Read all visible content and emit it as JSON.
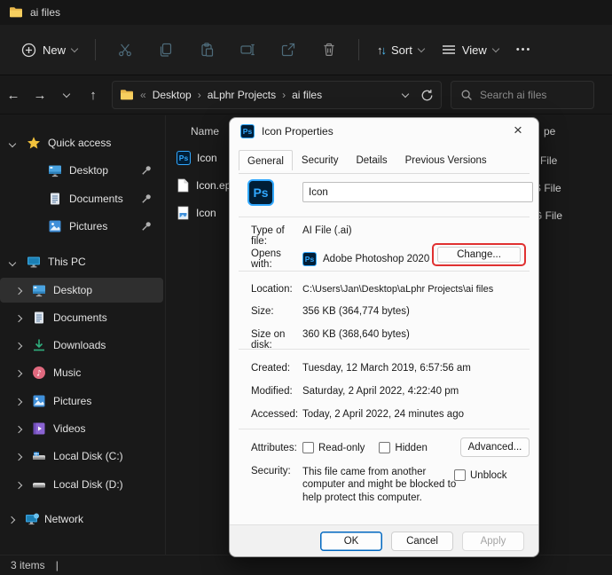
{
  "window": {
    "title": "ai files"
  },
  "icons": {
    "back": "←",
    "forward": "→",
    "up": "↑",
    "overflow": "«",
    "crumb_sep": "›",
    "ellipsis": "•••",
    "sort_up": "↑",
    "sort_down": "↓",
    "close": "×",
    "music_note": "♪",
    "status_divider": "|",
    "ps": "Ps"
  },
  "toolbar": {
    "new_label": "New",
    "sort_label": "Sort",
    "view_label": "View"
  },
  "addressbar": {
    "crumbs": [
      "Desktop",
      "aLphr Projects",
      "ai files"
    ]
  },
  "search": {
    "placeholder": "Search ai files"
  },
  "sidebar": {
    "quick_access": {
      "label": "Quick access",
      "items": [
        {
          "label": "Desktop"
        },
        {
          "label": "Documents"
        },
        {
          "label": "Pictures"
        }
      ]
    },
    "this_pc": {
      "label": "This PC",
      "items": [
        {
          "label": "Desktop"
        },
        {
          "label": "Documents"
        },
        {
          "label": "Downloads"
        },
        {
          "label": "Music"
        },
        {
          "label": "Pictures"
        },
        {
          "label": "Videos"
        },
        {
          "label": "Local Disk (C:)"
        },
        {
          "label": "Local Disk (D:)"
        }
      ]
    },
    "network": {
      "label": "Network"
    }
  },
  "filelist": {
    "name_header": "Name",
    "type_header_visible": "pe",
    "items": [
      {
        "name": "Icon",
        "type": "File"
      },
      {
        "name": "Icon.ep",
        "type": "S File"
      },
      {
        "name": "Icon",
        "type": "G File"
      }
    ]
  },
  "statusbar": {
    "count": "3 items"
  },
  "dialog": {
    "title": "Icon Properties",
    "tabs": [
      "General",
      "Security",
      "Details",
      "Previous Versions"
    ],
    "name_value": "Icon",
    "type_label": "Type of file:",
    "type_value": "AI File (.ai)",
    "opens_label": "Opens with:",
    "opens_value": "Adobe Photoshop 2020",
    "change_label": "Change...",
    "location_label": "Location:",
    "location_value": "C:\\Users\\Jan\\Desktop\\aLphr Projects\\ai files",
    "size_label": "Size:",
    "size_value": "356 KB (364,774 bytes)",
    "disk_label": "Size on disk:",
    "disk_value": "360 KB (368,640 bytes)",
    "created_label": "Created:",
    "created_value": "Tuesday, 12 March 2019, 6:57:56 am",
    "modified_label": "Modified:",
    "modified_value": "Saturday, 2 April 2022, 4:22:40 pm",
    "accessed_label": "Accessed:",
    "accessed_value": "Today, 2 April 2022, 24 minutes ago",
    "attributes_label": "Attributes:",
    "readonly_label": "Read-only",
    "hidden_label": "Hidden",
    "advanced_label": "Advanced...",
    "security_label": "Security:",
    "security_text": "This file came from another computer and might be blocked to help protect this computer.",
    "unblock_label": "Unblock",
    "ok_label": "OK",
    "cancel_label": "Cancel",
    "apply_label": "Apply"
  },
  "colors": {
    "accent": "#4cc2ff",
    "annotation": "#e03131",
    "ps_blue": "#31a8ff",
    "ps_dark": "#001e36",
    "folder_yellow": "#f6cf5f"
  }
}
